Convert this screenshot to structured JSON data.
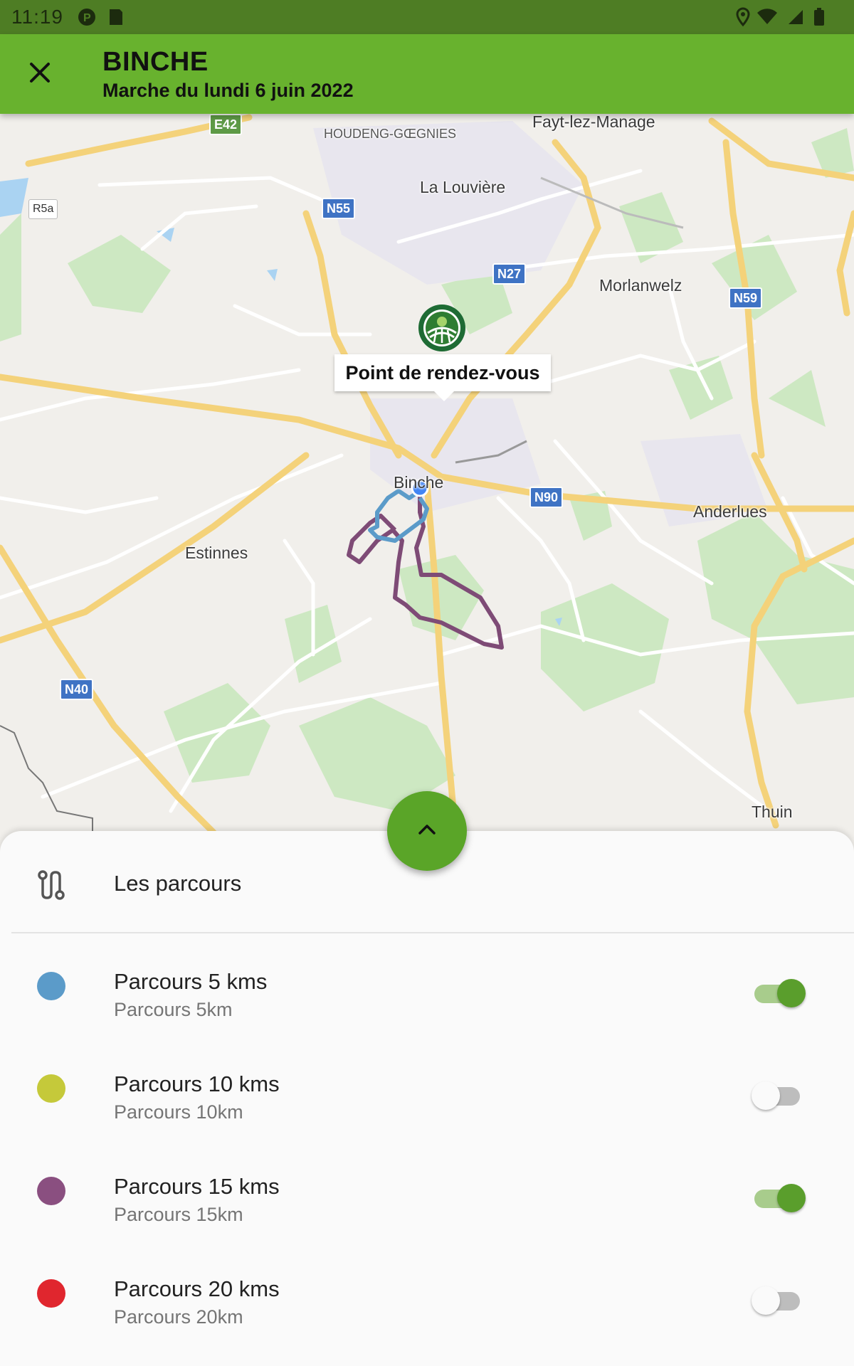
{
  "status": {
    "time": "11:19"
  },
  "header": {
    "title": "BINCHE",
    "subtitle": "Marche du lundi 6 juin 2022"
  },
  "map": {
    "callout": "Point de rendez-vous",
    "places": {
      "houdeng": "HOUDENG-GŒGNIES",
      "fayt": "Fayt-lez-Manage",
      "louviere": "La Louvière",
      "morlanwelz": "Morlanwelz",
      "binche": "Binche",
      "anderlues": "Anderlues",
      "estinnes": "Estinnes",
      "thuin": "Thuin"
    },
    "roads": {
      "e42": "E42",
      "r5a": "R5a",
      "n55": "N55",
      "n27": "N27",
      "n59": "N59",
      "n90": "N90",
      "n40": "N40"
    }
  },
  "sheet": {
    "title": "Les parcours",
    "routes": [
      {
        "title": "Parcours 5 kms",
        "subtitle": "Parcours 5km",
        "color": "#5b9bc9",
        "enabled": true
      },
      {
        "title": "Parcours 10 kms",
        "subtitle": "Parcours 10km",
        "color": "#c5c93a",
        "enabled": false
      },
      {
        "title": "Parcours 15 kms",
        "subtitle": "Parcours 15km",
        "color": "#8a4f80",
        "enabled": true
      },
      {
        "title": "Parcours 20 kms",
        "subtitle": "Parcours 20km",
        "color": "#e0262e",
        "enabled": false
      }
    ]
  },
  "colors": {
    "appbar": "#68b22e",
    "statusbar": "#4e7d24",
    "accent": "#5aa528"
  }
}
